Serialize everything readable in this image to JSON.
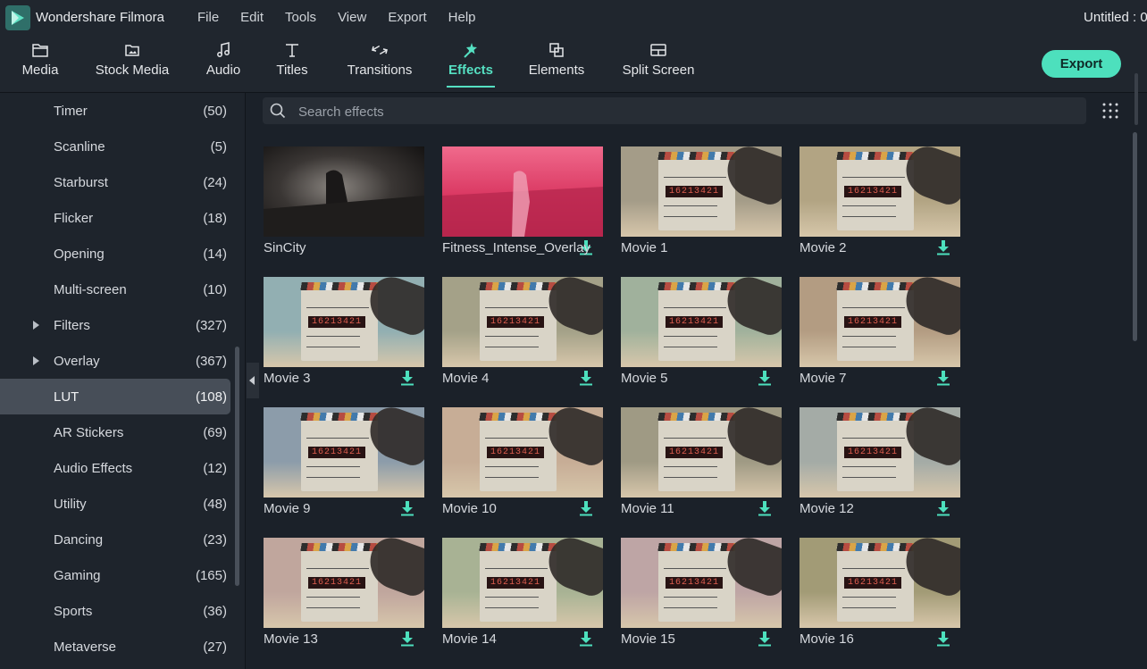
{
  "app": {
    "name": "Wondershare Filmora",
    "document_title": "Untitled : 0"
  },
  "menu": [
    "File",
    "Edit",
    "Tools",
    "View",
    "Export",
    "Help"
  ],
  "toolbar": {
    "tabs": [
      {
        "label": "Media",
        "icon": "folder-icon"
      },
      {
        "label": "Stock Media",
        "icon": "stock-media-icon"
      },
      {
        "label": "Audio",
        "icon": "music-note-icon"
      },
      {
        "label": "Titles",
        "icon": "text-icon"
      },
      {
        "label": "Transitions",
        "icon": "transition-icon"
      },
      {
        "label": "Effects",
        "icon": "effects-icon"
      },
      {
        "label": "Elements",
        "icon": "elements-icon"
      },
      {
        "label": "Split Screen",
        "icon": "split-screen-icon"
      }
    ],
    "active": "Effects",
    "export_label": "Export",
    "accent": "#55e0c2"
  },
  "sidebar": {
    "categories": [
      {
        "name": "Timer",
        "count": "(50)"
      },
      {
        "name": "Scanline",
        "count": "(5)"
      },
      {
        "name": "Starburst",
        "count": "(24)"
      },
      {
        "name": "Flicker",
        "count": "(18)"
      },
      {
        "name": "Opening",
        "count": "(14)"
      },
      {
        "name": "Multi-screen",
        "count": "(10)"
      },
      {
        "name": "Filters",
        "count": "(327)",
        "expandable": true
      },
      {
        "name": "Overlay",
        "count": "(367)",
        "expandable": true
      },
      {
        "name": "LUT",
        "count": "(108)",
        "selected": true
      },
      {
        "name": "AR Stickers",
        "count": "(69)"
      },
      {
        "name": "Audio Effects",
        "count": "(12)"
      },
      {
        "name": "Utility",
        "count": "(48)"
      },
      {
        "name": "Dancing",
        "count": "(23)"
      },
      {
        "name": "Gaming",
        "count": "(165)"
      },
      {
        "name": "Sports",
        "count": "(36)"
      },
      {
        "name": "Metaverse",
        "count": "(27)"
      }
    ]
  },
  "search": {
    "placeholder": "Search effects",
    "value": ""
  },
  "effects": [
    {
      "title": "SinCity",
      "tint": "#2b2b2b",
      "downloaded": true
    },
    {
      "title": "Fitness_Intense_Overlay",
      "tint": "#e0456e",
      "downloaded": false
    },
    {
      "title": "Movie 1",
      "tint": "#a59c86",
      "downloaded": true
    },
    {
      "title": "Movie 2",
      "tint": "#b3a47f",
      "downloaded": false
    },
    {
      "title": "Movie 3",
      "tint": "#8fb0b3",
      "downloaded": false
    },
    {
      "title": "Movie 4",
      "tint": "#a4a185",
      "downloaded": false
    },
    {
      "title": "Movie 5",
      "tint": "#9fb29a",
      "downloaded": false
    },
    {
      "title": "Movie 7",
      "tint": "#b59c7f",
      "downloaded": false
    },
    {
      "title": "Movie 9",
      "tint": "#8a9cac",
      "downloaded": false
    },
    {
      "title": "Movie 10",
      "tint": "#c9ad93",
      "downloaded": false
    },
    {
      "title": "Movie 11",
      "tint": "#a09a82",
      "downloaded": false
    },
    {
      "title": "Movie 12",
      "tint": "#a3aba6",
      "downloaded": false
    },
    {
      "title": "Movie 13",
      "tint": "#c2a59c",
      "downloaded": false
    },
    {
      "title": "Movie 14",
      "tint": "#a7b391",
      "downloaded": false
    },
    {
      "title": "Movie 15",
      "tint": "#c0a4a4",
      "downloaded": false
    },
    {
      "title": "Movie 16",
      "tint": "#a39b72",
      "downloaded": false
    }
  ],
  "clapper_text": "16213421"
}
